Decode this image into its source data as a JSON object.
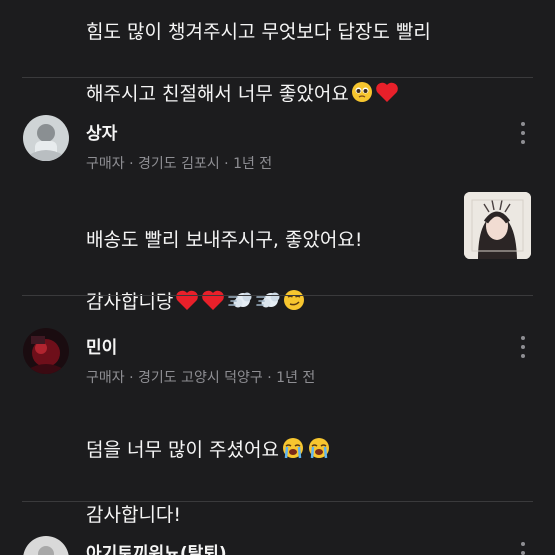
{
  "reviews": [
    {
      "text_line1": "힘도 많이 챙겨주시고 무엇보다 답장도 빨리",
      "text_line2": "해주시고 친절해서 너무 좋았어요",
      "emojis": [
        "pleading-face-icon",
        "red-heart-icon"
      ]
    },
    {
      "username": "상자",
      "meta": "구매자 · 경기도 김포시 · 1년 전",
      "text_line1": "배송도 빨리 보내주시구, 좋았어요!",
      "text_line2": "감사합니당",
      "emojis": [
        "red-heart-icon",
        "red-heart-icon",
        "dashing-away-icon",
        "dashing-away-icon",
        "smirking-face-icon"
      ],
      "has_photo": true
    },
    {
      "username": "민이",
      "meta": "구매자 · 경기도 고양시 덕양구 · 1년 전",
      "text_line1": "덤을 너무 많이 주셨어요",
      "text_line2": "감사합니다!",
      "emojis": [
        "loudly-crying-face-icon",
        "loudly-crying-face-icon"
      ]
    },
    {
      "username": "아기토끼워뇨(탈퇴)"
    }
  ],
  "colors": {
    "background": "#1c1c1e",
    "text": "#f5f5f5",
    "meta": "#8e8e93",
    "divider": "#3a3a3c",
    "heart": "#e8202a",
    "emoji_yellow": "#f7c62f"
  }
}
